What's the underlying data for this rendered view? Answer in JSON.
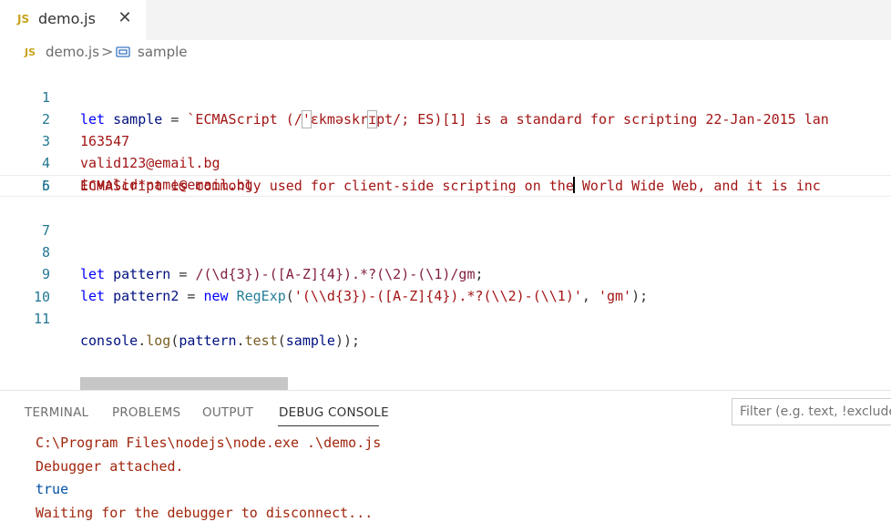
{
  "tab": {
    "badge": "JS",
    "title": "demo.js",
    "close": "✕"
  },
  "breadcrumb": {
    "badge": "JS",
    "file": "demo.js",
    "separator": ">",
    "symbol": "sample"
  },
  "editor": {
    "lines": [
      {
        "n": "1",
        "text": "let sample = `ECMAScript (/'ɛkməskrɪpt/; ES)[1] is a standard for scripting 22-Jan-2015 lan"
      },
      {
        "n": "2",
        "text": "163547"
      },
      {
        "n": "3",
        "text": "valid123@email.bg"
      },
      {
        "n": "4",
        "text": "invalid*name@email.bg"
      },
      {
        "n": "5",
        "text": ""
      },
      {
        "n": "6",
        "text": "ECMAScript is commonly used for client-side scripting on the World Wide Web, and it is inc"
      },
      {
        "n": "7",
        "text": ""
      },
      {
        "n": "8",
        "text": "let pattern = /(\\d{3})-([A-Z]{4}).*?(\\2)-(\\1)/gm;"
      },
      {
        "n": "9",
        "text": "let pattern2 = new RegExp('(\\\\d{3})-([A-Z]{4}).*?(\\\\2)-(\\\\1)', 'gm');"
      },
      {
        "n": "10",
        "text": ""
      },
      {
        "n": "11",
        "text": "console.log(pattern.test(sample));"
      }
    ],
    "line1": {
      "kw": "let",
      "var": "sample",
      "eq": " = ",
      "pre": "`ECMAScript (/",
      "q1": "'",
      "mid": "ɛkməskr",
      "q2": "ɪ",
      "post": "pt/; ES)[1] is a standard for scripting 22-Jan-2015 lan"
    },
    "line6": {
      "before": "ECMAScript is commonly used for client-side scripting on the",
      "after": " World Wide Web, and it is inc"
    },
    "line8": {
      "kw": "let",
      "var": "pattern",
      "eq": " = ",
      "rx": "/(\\d{3})-([A-Z]{4}).*?(\\2)-(\\1)/gm",
      "end": ";"
    },
    "line9": {
      "kw": "let",
      "var": "pattern2",
      "eq": " = ",
      "new": "new",
      "cls": "RegExp",
      "open": "(",
      "str1": "'(\\\\d{3})-([A-Z]{4}).*?(\\\\2)-(\\\\1)'",
      "comma": ", ",
      "str2": "'gm'",
      "end": ");"
    },
    "line11": {
      "obj": "console",
      "dot1": ".",
      "fn1": "log",
      "p1": "(",
      "var": "pattern",
      "dot2": ".",
      "fn2": "test",
      "p2": "(",
      "arg": "sample",
      "end": "));"
    }
  },
  "panel": {
    "tabs": [
      "TERMINAL",
      "PROBLEMS",
      "OUTPUT",
      "DEBUG CONSOLE"
    ],
    "active_tab": "DEBUG CONSOLE",
    "filter_placeholder": "Filter (e.g. text, !exclude)",
    "console": [
      "C:\\Program Files\\nodejs\\node.exe .\\demo.js",
      "Debugger attached.",
      "true",
      "Waiting for the debugger to disconnect..."
    ]
  },
  "colors": {
    "keyword": "#0000ff",
    "string": "#a31515",
    "function": "#795e26",
    "variable": "#001080",
    "line_number": "#237893",
    "js_badge": "#c8a31d"
  }
}
